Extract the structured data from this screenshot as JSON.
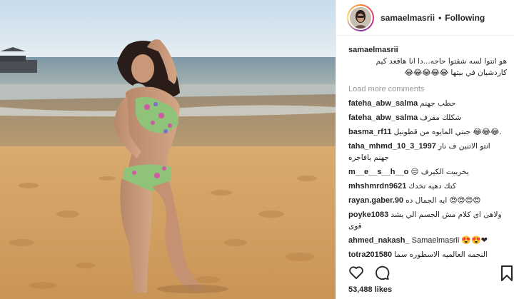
{
  "post": {
    "username": "samaelmasrii",
    "separator": "•",
    "follow_status": "Following",
    "caption_user": "samaelmasrii",
    "caption_text": "هو انتوا لسه شفتوا حاجه...دا انا هاقعد كيم كاردشيان في بيتها 😂😂😂😂😂",
    "load_more": "Load more comments",
    "likes": "53,488 likes"
  },
  "comments": [
    {
      "user": "fateha_abw_salma",
      "text": "حطب جهنم"
    },
    {
      "user": "fateha_abw_salma",
      "text": "شكلك مقرف"
    },
    {
      "user": "basma_rf11",
      "text": "جبتي المايوه من قطونيل 😂😂😂."
    },
    {
      "user": "taha_mhmd_10_3_1997",
      "text": "انتو الاتنين ف نار جهنم يافاجره"
    },
    {
      "user": "m__e__s__h__o",
      "text": "😒 يخربيت الكيرف"
    },
    {
      "user": "mhshmrdn9621",
      "text": "كتك دهيه تخدك"
    },
    {
      "user": "rayan.gaber.90",
      "text": "ايه الجمال ده 😍😍😍😍"
    },
    {
      "user": "poyke1083",
      "text": "ولاهى اى كلام مش الجسم الي يشد قوى"
    },
    {
      "user": "ahmed_nakash_",
      "text": "Samaelmasrii 😍😍❤"
    },
    {
      "user": "totra201580",
      "text": "النجمه العالميه الاسطوره سما المصري عاوزين نشوفك في عمل فني مع الفنان"
    }
  ],
  "icons": [
    "heart-icon",
    "comment-icon",
    "bookmark-icon"
  ],
  "colors": {
    "sky_top": "#c9dcea",
    "sea": "#7e97a3",
    "sand": "#d8a869",
    "text": "#262626",
    "muted": "#999999"
  }
}
